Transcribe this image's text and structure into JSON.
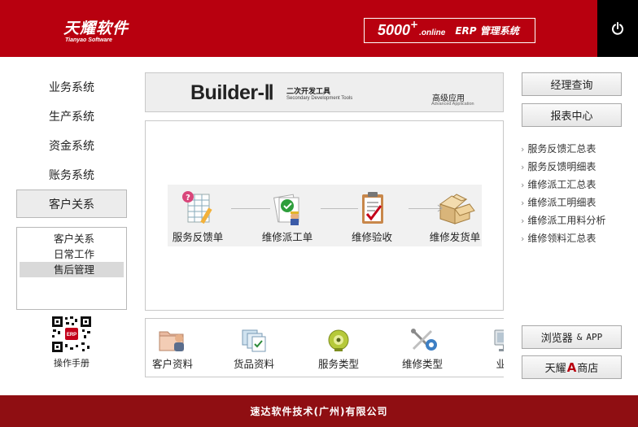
{
  "header": {
    "logo_cn": "天耀软件",
    "logo_en": "Tianyao Software",
    "erp_number": "5000",
    "erp_plus": "+",
    "erp_online": ".online",
    "erp_title": "ERP 管理系统",
    "power_icon": "power-icon",
    "accent": "#b8000f"
  },
  "nav": {
    "items": [
      {
        "label": "业务系统"
      },
      {
        "label": "生产系统"
      },
      {
        "label": "资金系统"
      },
      {
        "label": "账务系统"
      },
      {
        "label": "客户关系",
        "active": true
      }
    ],
    "submenu": [
      {
        "label": "客户关系"
      },
      {
        "label": "日常工作"
      },
      {
        "label": "售后管理",
        "selected": true
      }
    ],
    "manual_label": "操作手册",
    "qr_icon": "qr-code-icon"
  },
  "banner": {
    "title": "Builder-Ⅱ",
    "sub_cn": "二次开发工具",
    "sub_en": "Secondary Development Tools",
    "right_cn": "高级应用",
    "right_en": "Advanced Application"
  },
  "flow": {
    "steps": [
      {
        "label": "服务反馈单",
        "icon": "feedback-form-icon"
      },
      {
        "label": "维修派工单",
        "icon": "dispatch-order-icon"
      },
      {
        "label": "维修验收",
        "icon": "clipboard-check-icon"
      },
      {
        "label": "维修发货单",
        "icon": "package-box-icon"
      }
    ]
  },
  "modules": [
    {
      "label": "客户资料",
      "icon": "customer-folder-icon"
    },
    {
      "label": "货品资料",
      "icon": "goods-data-icon"
    },
    {
      "label": "服务类型",
      "icon": "service-type-icon"
    },
    {
      "label": "维修类型",
      "icon": "repair-tools-icon"
    },
    {
      "label": "业务",
      "icon": "monitor-icon"
    }
  ],
  "right": {
    "btn_manager": "经理查询",
    "btn_reports": "报表中心",
    "links": [
      "服务反馈汇总表",
      "服务反馈明细表",
      "维修派工汇总表",
      "维修派工明细表",
      "维修派工用料分析",
      "维修领料汇总表"
    ],
    "btn_browser_cn": "浏览器",
    "btn_browser_sep": "&",
    "btn_browser_app": "APP",
    "btn_store_pre": "天耀",
    "btn_store_a": "A",
    "btn_store_post": "商店"
  },
  "footer": {
    "company": "速达软件技术(广州)有限公司"
  }
}
